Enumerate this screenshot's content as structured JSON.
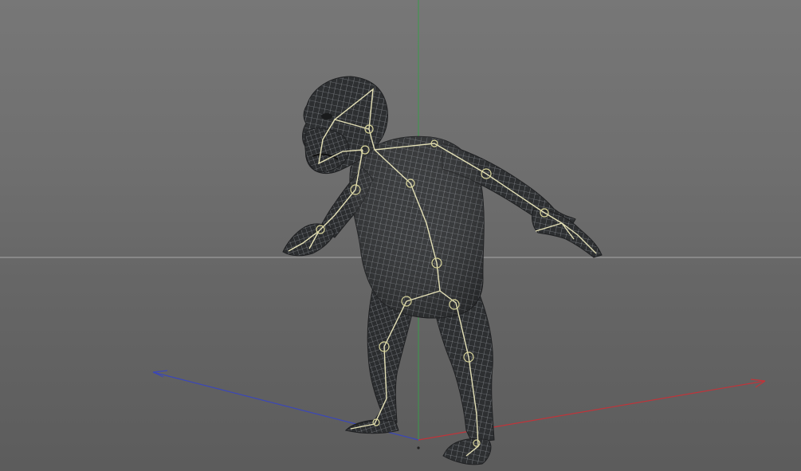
{
  "viewport": {
    "name": "3d-viewport",
    "background": "#6f6f6f",
    "horizon_color": "#b9b9b9",
    "axis_colors": {
      "x": "#c0343a",
      "y": "#3a9a4a",
      "z": "#3b47b8"
    }
  },
  "scene": {
    "model": "ape-character-wireframe",
    "mesh_color": "#2e3032",
    "mesh_wire_color": "#c9cdd3",
    "rig_color": "#e4e0b6"
  }
}
